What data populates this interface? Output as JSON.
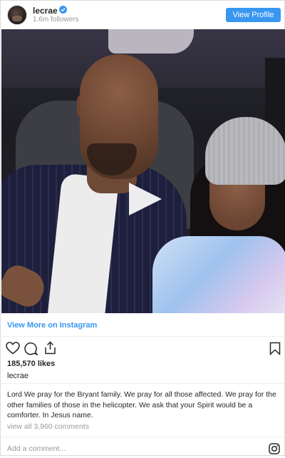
{
  "header": {
    "username": "lecrae",
    "followers": "1.6m followers",
    "view_profile_label": "View Profile"
  },
  "media": {
    "type": "video"
  },
  "footer": {
    "view_more_label": "View More on Instagram",
    "likes": "185,570 likes",
    "username": "lecrae",
    "caption": "Lord We pray for the Bryant family. We pray for all those affected. We pray for the other families of those in the helicopter. We ask that your Spirit would be a comforter. In Jesus name.",
    "view_all_comments": "view all 3,960 comments",
    "add_comment_placeholder": "Add a comment..."
  },
  "icons": [
    "verified-badge-icon",
    "play-icon",
    "heart-icon",
    "comment-icon",
    "share-icon",
    "save-icon",
    "instagram-icon"
  ],
  "colors": {
    "accent": "#3897f0",
    "text": "#262626",
    "muted": "#999999"
  }
}
